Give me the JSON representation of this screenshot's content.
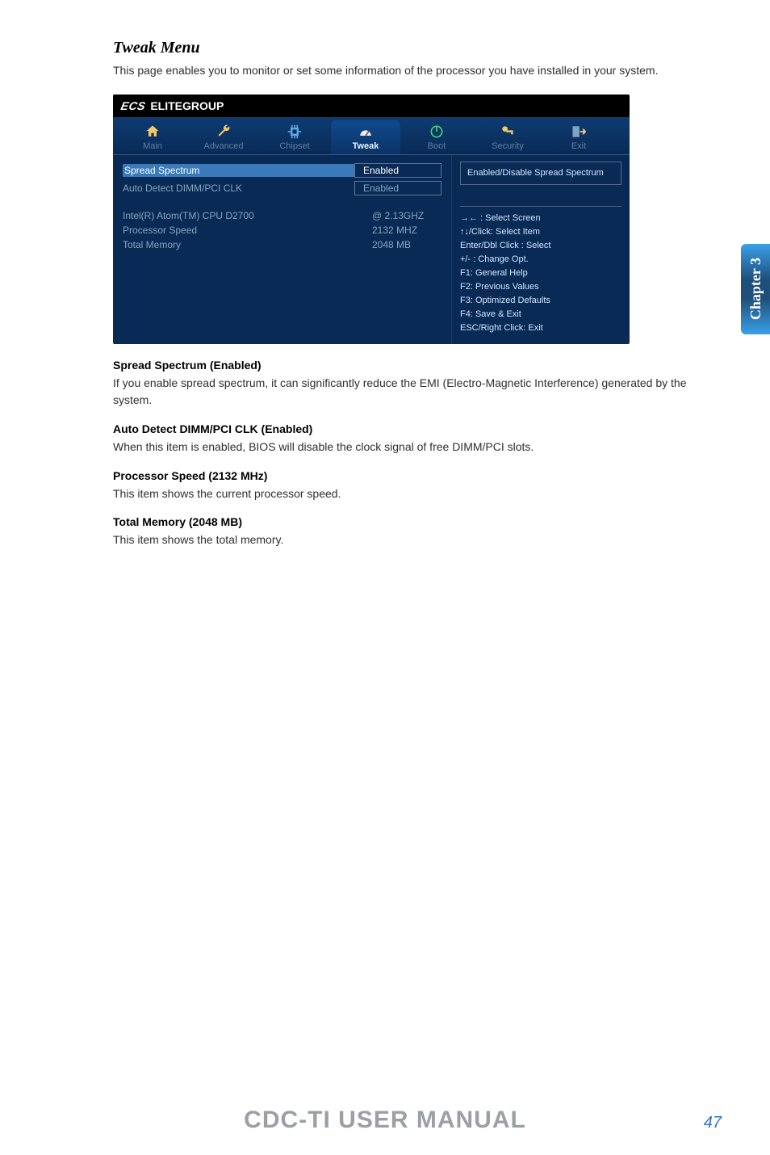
{
  "section": {
    "title": "Tweak Menu",
    "lead": "This page enables you to monitor or set some information of the processor you have installed in your system."
  },
  "bios": {
    "brand": "ELITEGROUP",
    "tabs": [
      {
        "label": "Main",
        "icon": "home-icon",
        "active": false
      },
      {
        "label": "Advanced",
        "icon": "wrench-icon",
        "active": false
      },
      {
        "label": "Chipset",
        "icon": "chip-icon",
        "active": false
      },
      {
        "label": "Tweak",
        "icon": "gauge-icon",
        "active": true
      },
      {
        "label": "Boot",
        "icon": "power-icon",
        "active": false
      },
      {
        "label": "Security",
        "icon": "key-icon",
        "active": false
      },
      {
        "label": "Exit",
        "icon": "exit-icon",
        "active": false
      }
    ],
    "left_rows": [
      {
        "label": "Spread Spectrum",
        "value": "Enabled",
        "boxed": true,
        "selected": true
      },
      {
        "label": "Auto Detect DIMM/PCI CLK",
        "value": "Enabled",
        "boxed": true,
        "dim": true
      },
      {
        "gap": true
      },
      {
        "label": "Intel(R) Atom(TM) CPU D2700",
        "value": "@ 2.13GHZ",
        "dim": true
      },
      {
        "label": "Processor Speed",
        "value": "2132 MHZ",
        "dim": true
      },
      {
        "label": "Total Memory",
        "value": "2048 MB",
        "dim": true
      }
    ],
    "right_box": "Enabled/Disable Spread Spectrum",
    "help_lines": [
      "→←   : Select Screen",
      "↑↓/Click: Select Item",
      "Enter/Dbl Click : Select",
      "+/- : Change Opt.",
      "F1: General Help",
      "F2: Previous Values",
      "F3: Optimized Defaults",
      "F4: Save & Exit",
      "ESC/Right Click: Exit"
    ]
  },
  "entries": [
    {
      "heading": "Spread Spectrum (Enabled)",
      "body": "If you enable spread spectrum, it can significantly reduce the EMI (Electro-Magnetic Interference) generated by the system."
    },
    {
      "heading": "Auto Detect DIMM/PCI CLK (Enabled)",
      "body": "When this item is enabled, BIOS will disable the clock signal of free DIMM/PCI slots."
    },
    {
      "heading": "Processor Speed (2132 MHz)",
      "body": "This item shows the current processor speed."
    },
    {
      "heading": "Total Memory (2048 MB)",
      "body": "This item shows the total memory."
    }
  ],
  "side_tab": "Chapter 3",
  "footer": {
    "brand": "CDC-TI USER MANUAL",
    "page": "47"
  }
}
